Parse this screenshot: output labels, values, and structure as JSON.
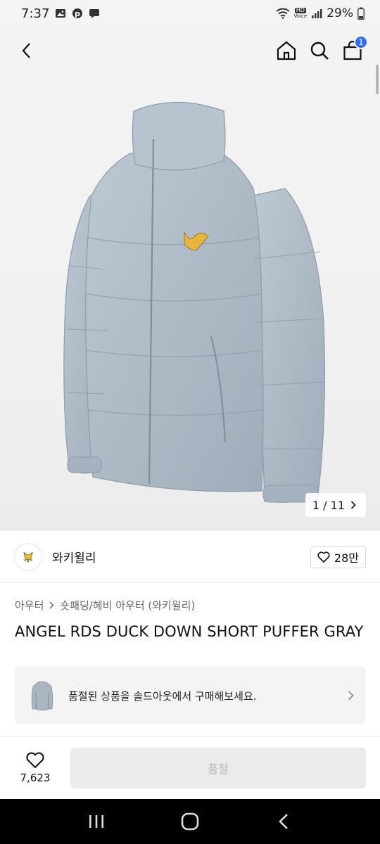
{
  "status": {
    "time": "7:37",
    "left_icons": [
      "gallery-icon",
      "pinterest-icon",
      "chat-icon"
    ],
    "right_icons": [
      "wifi-icon",
      "hd-voice-icon",
      "signal-icon"
    ],
    "hd_label": "HD",
    "voice_label": "Voice",
    "battery": "29%"
  },
  "nav": {
    "back_icon": "back-chevron-icon",
    "home_icon": "home-icon",
    "search_icon": "search-icon",
    "cart_icon": "shopping-bag-icon",
    "cart_count": "1",
    "cart_badge_color": "#2f6bff"
  },
  "gallery": {
    "counter": "1 / 11",
    "image": "gray-puffer-jacket-product-photo"
  },
  "brand": {
    "name": "와키윌리",
    "logo": "wackywilly-logo",
    "likes": "28만"
  },
  "breadcrumb": {
    "level1": "아우터",
    "separator": ">",
    "level2": "숏패딩/헤비 아우터 (와키윌리)"
  },
  "product": {
    "title": "ANGEL RDS DUCK DOWN SHORT PUFFER GRAY"
  },
  "soldout_banner": {
    "text": "품절된 상품을 솔드아웃에서 구매해보세요."
  },
  "bottom": {
    "wish_count": "7,623",
    "buy_label": "품절"
  },
  "system_nav": [
    "recents-icon",
    "home-icon",
    "back-icon"
  ]
}
